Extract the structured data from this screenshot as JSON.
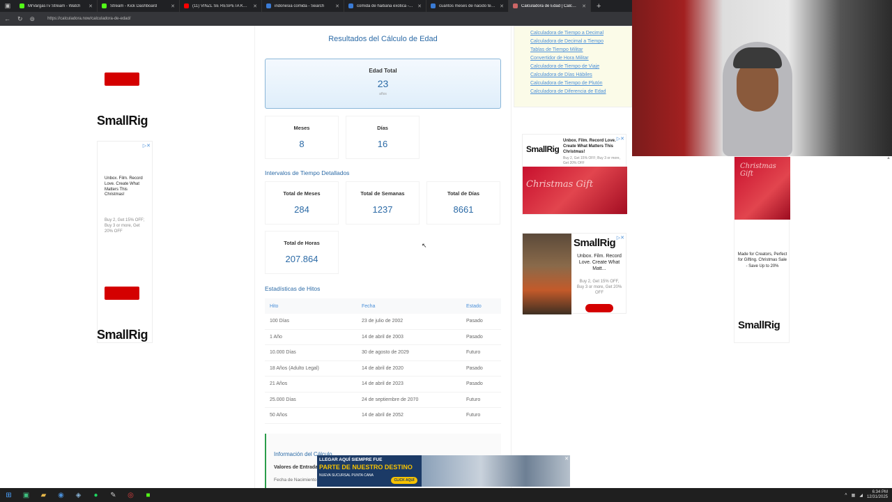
{
  "browser": {
    "tabs": [
      {
        "label": "MrVargasTv Stream - Watch",
        "color": "#53fc18"
      },
      {
        "label": "Stream - Kick Dashboard",
        "color": "#53fc18"
      },
      {
        "label": "(11) VINZL SE RESPETA KRIS PERRI",
        "color": "#ff0000"
      },
      {
        "label": "indonesia comida - Search",
        "color": "#3a7bd5"
      },
      {
        "label": "comida de haitiana exotica - Sear",
        "color": "#3a7bd5"
      },
      {
        "label": "cuantos meses de nacido tengo",
        "color": "#3a7bd5"
      },
      {
        "label": "Calculadora de Edad | Calculado",
        "color": "#cc6666"
      }
    ],
    "url": "https://calculadora.now/calculadora-de-edad/"
  },
  "results": {
    "title": "Resultados del Cálculo de Edad",
    "total_label": "Edad Total",
    "total_value": "23",
    "total_unit": "años",
    "months_label": "Meses",
    "months_value": "8",
    "days_label": "Días",
    "days_value": "16"
  },
  "intervals": {
    "heading": "Intervalos de Tiempo Detallados",
    "items": [
      {
        "label": "Total de Meses",
        "value": "284"
      },
      {
        "label": "Total de Semanas",
        "value": "1237"
      },
      {
        "label": "Total de Días",
        "value": "8661"
      },
      {
        "label": "Total de Horas",
        "value": "207.864"
      }
    ]
  },
  "milestones": {
    "heading": "Estadísticas de Hitos",
    "columns": [
      "Hito",
      "Fecha",
      "Estado"
    ],
    "rows": [
      [
        "100 Días",
        "23 de julio de 2002",
        "Pasado"
      ],
      [
        "1 Año",
        "14 de abril de 2003",
        "Pasado"
      ],
      [
        "10.000 Días",
        "30 de agosto de 2029",
        "Futuro"
      ],
      [
        "18 Años (Adulto Legal)",
        "14 de abril de 2020",
        "Pasado"
      ],
      [
        "21 Años",
        "14 de abril de 2023",
        "Pasado"
      ],
      [
        "25.000 Días",
        "24 de septiembre de 2070",
        "Futuro"
      ],
      [
        "50 Años",
        "14 de abril de 2052",
        "Futuro"
      ]
    ]
  },
  "info": {
    "title": "Información del Cálculo",
    "line1": "Valores de Entrada",
    "line2": "Fecha de Nacimiento"
  },
  "sidebar": {
    "links": [
      "Calculadora de Tiempo a Decimal",
      "Calculadora de Decimal a Tiempo",
      "Tablas de Tiempo Militar",
      "Convertidor de Hora Militar",
      "Calculadora de Tiempo de Viaje",
      "Calculadora de Días Hábiles",
      "Calculadora de Tiempo de Plutón",
      "Calculadora de Diferencia de Edad"
    ]
  },
  "ads": {
    "brand": "SmallRig",
    "left_text": "Unbox. Film. Record Love. Create What Matters This Christmas!",
    "left_offer": "Buy 2, Get 15% OFF; Buy 3 or more, Get 20% OFF",
    "right1_text": "Unbox. Film. Record Love. Create What Matters This Christmas!",
    "right1_offer": "Buy 2, Get 15% OFF; Buy 3 or more, Get 20% OFF",
    "xmas": "Christmas Gift",
    "right2_text": "Unbox. Film. Record Love. Create What Matt...",
    "right2_offer": "Buy 2, Get 15% OFF, Buy 3 or more, Get 20% OFF",
    "right3_text": "Made for Creators, Perfect for Gifting. Christmas Sale - Save Up to 20%",
    "bottom_l1": "LLEGAR AQUÍ SIEMPRE FUE",
    "bottom_l2": "PARTE DE NUESTRO DESTINO",
    "bottom_l3": "NUEVA SUCURSAL PUNTA CANA",
    "bottom_cta": "CLICK AQUÍ"
  },
  "taskbar": {
    "time": "6:34 PM",
    "date": "12/31/2025"
  }
}
